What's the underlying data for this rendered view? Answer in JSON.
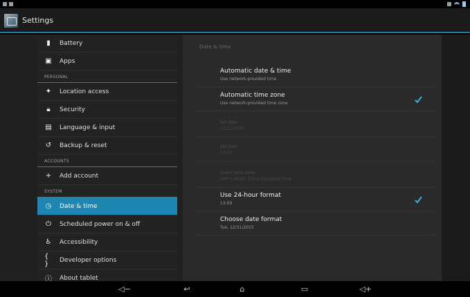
{
  "actionbar": {
    "title": "Settings"
  },
  "sidebar": {
    "items": [
      {
        "type": "item",
        "label": "Battery",
        "icon": "battery-icon",
        "glyph": "▮"
      },
      {
        "type": "item",
        "label": "Apps",
        "icon": "apps-icon",
        "glyph": "▣"
      },
      {
        "type": "header",
        "label": "PERSONAL"
      },
      {
        "type": "item",
        "label": "Location access",
        "icon": "location-icon",
        "glyph": "✦"
      },
      {
        "type": "item",
        "label": "Security",
        "icon": "lock-icon",
        "glyph": "🔒︎"
      },
      {
        "type": "item",
        "label": "Language & input",
        "icon": "keyboard-icon",
        "glyph": "▤"
      },
      {
        "type": "item",
        "label": "Backup & reset",
        "icon": "backup-icon",
        "glyph": "↺"
      },
      {
        "type": "header",
        "label": "ACCOUNTS"
      },
      {
        "type": "item",
        "label": "Add account",
        "icon": "add-icon",
        "glyph": "+"
      },
      {
        "type": "header",
        "label": "SYSTEM"
      },
      {
        "type": "item",
        "label": "Date & time",
        "icon": "clock-icon",
        "glyph": "◷",
        "active": true
      },
      {
        "type": "item",
        "label": "Scheduled power on & off",
        "icon": "power-icon",
        "glyph": "⏻︎"
      },
      {
        "type": "item",
        "label": "Accessibility",
        "icon": "accessibility-icon",
        "glyph": "♿︎"
      },
      {
        "type": "item",
        "label": "Developer options",
        "icon": "developer-icon",
        "glyph": "{ }"
      },
      {
        "type": "item",
        "label": "About tablet",
        "icon": "info-icon",
        "glyph": "ⓘ"
      }
    ]
  },
  "panel": {
    "title": "Date & time",
    "prefs": [
      {
        "title": "Automatic date & time",
        "summary": "Use network-provided time",
        "checked": false,
        "enabled": true
      },
      {
        "title": "Automatic time zone",
        "summary": "Use network-provided time zone",
        "checked": true,
        "enabled": true
      },
      {
        "title": "Set date",
        "summary": "12/31/2015",
        "checked": false,
        "enabled": false
      },
      {
        "title": "Set time",
        "summary": "13:00",
        "checked": false,
        "enabled": false
      },
      {
        "title": "Select time zone",
        "summary": "GMT+08:00, China Standard Time",
        "checked": false,
        "enabled": false
      },
      {
        "title": "Use 24-hour format",
        "summary": "13:00",
        "checked": true,
        "enabled": true
      },
      {
        "title": "Choose date format",
        "summary": "Tue, 12/31/2015",
        "checked": false,
        "enabled": true
      }
    ]
  },
  "navbar": {
    "buttons": [
      {
        "name": "volume-down-icon",
        "glyph": "◁−"
      },
      {
        "name": "back-icon",
        "glyph": "↩"
      },
      {
        "name": "home-icon",
        "glyph": "⌂"
      },
      {
        "name": "recent-apps-icon",
        "glyph": "▭"
      },
      {
        "name": "volume-up-icon",
        "glyph": "◁+"
      }
    ]
  },
  "colors": {
    "accent": "#1f86b2",
    "background": "#202020",
    "check": "#33b5e5"
  }
}
